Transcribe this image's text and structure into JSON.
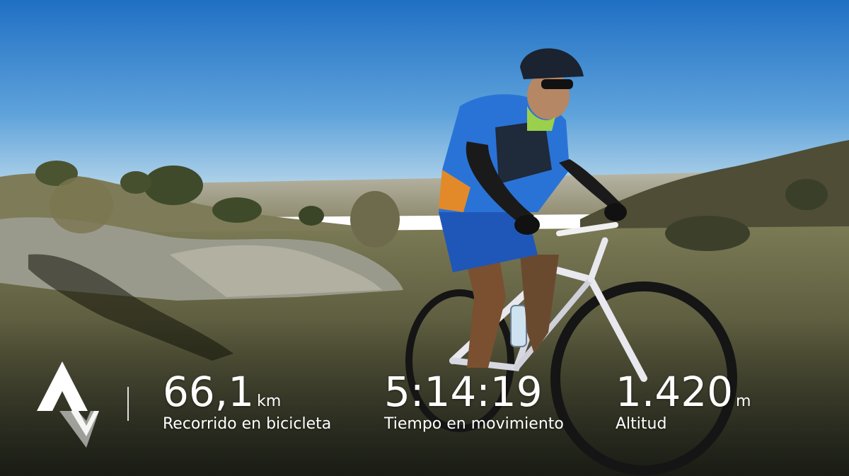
{
  "colors": {
    "sky_top": "#1f6fc4",
    "sky_horizon": "#a9cfe6",
    "overlay_text": "#ffffff"
  },
  "logo": {
    "icon": "strava-logo-icon"
  },
  "stats": [
    {
      "value": "66,1",
      "unit": "km",
      "label": "Recorrido en bicicleta"
    },
    {
      "value": "5:14:19",
      "unit": "",
      "label": "Tiempo en movimiento"
    },
    {
      "value": "1.420",
      "unit": "m",
      "label": "Altitud"
    }
  ]
}
